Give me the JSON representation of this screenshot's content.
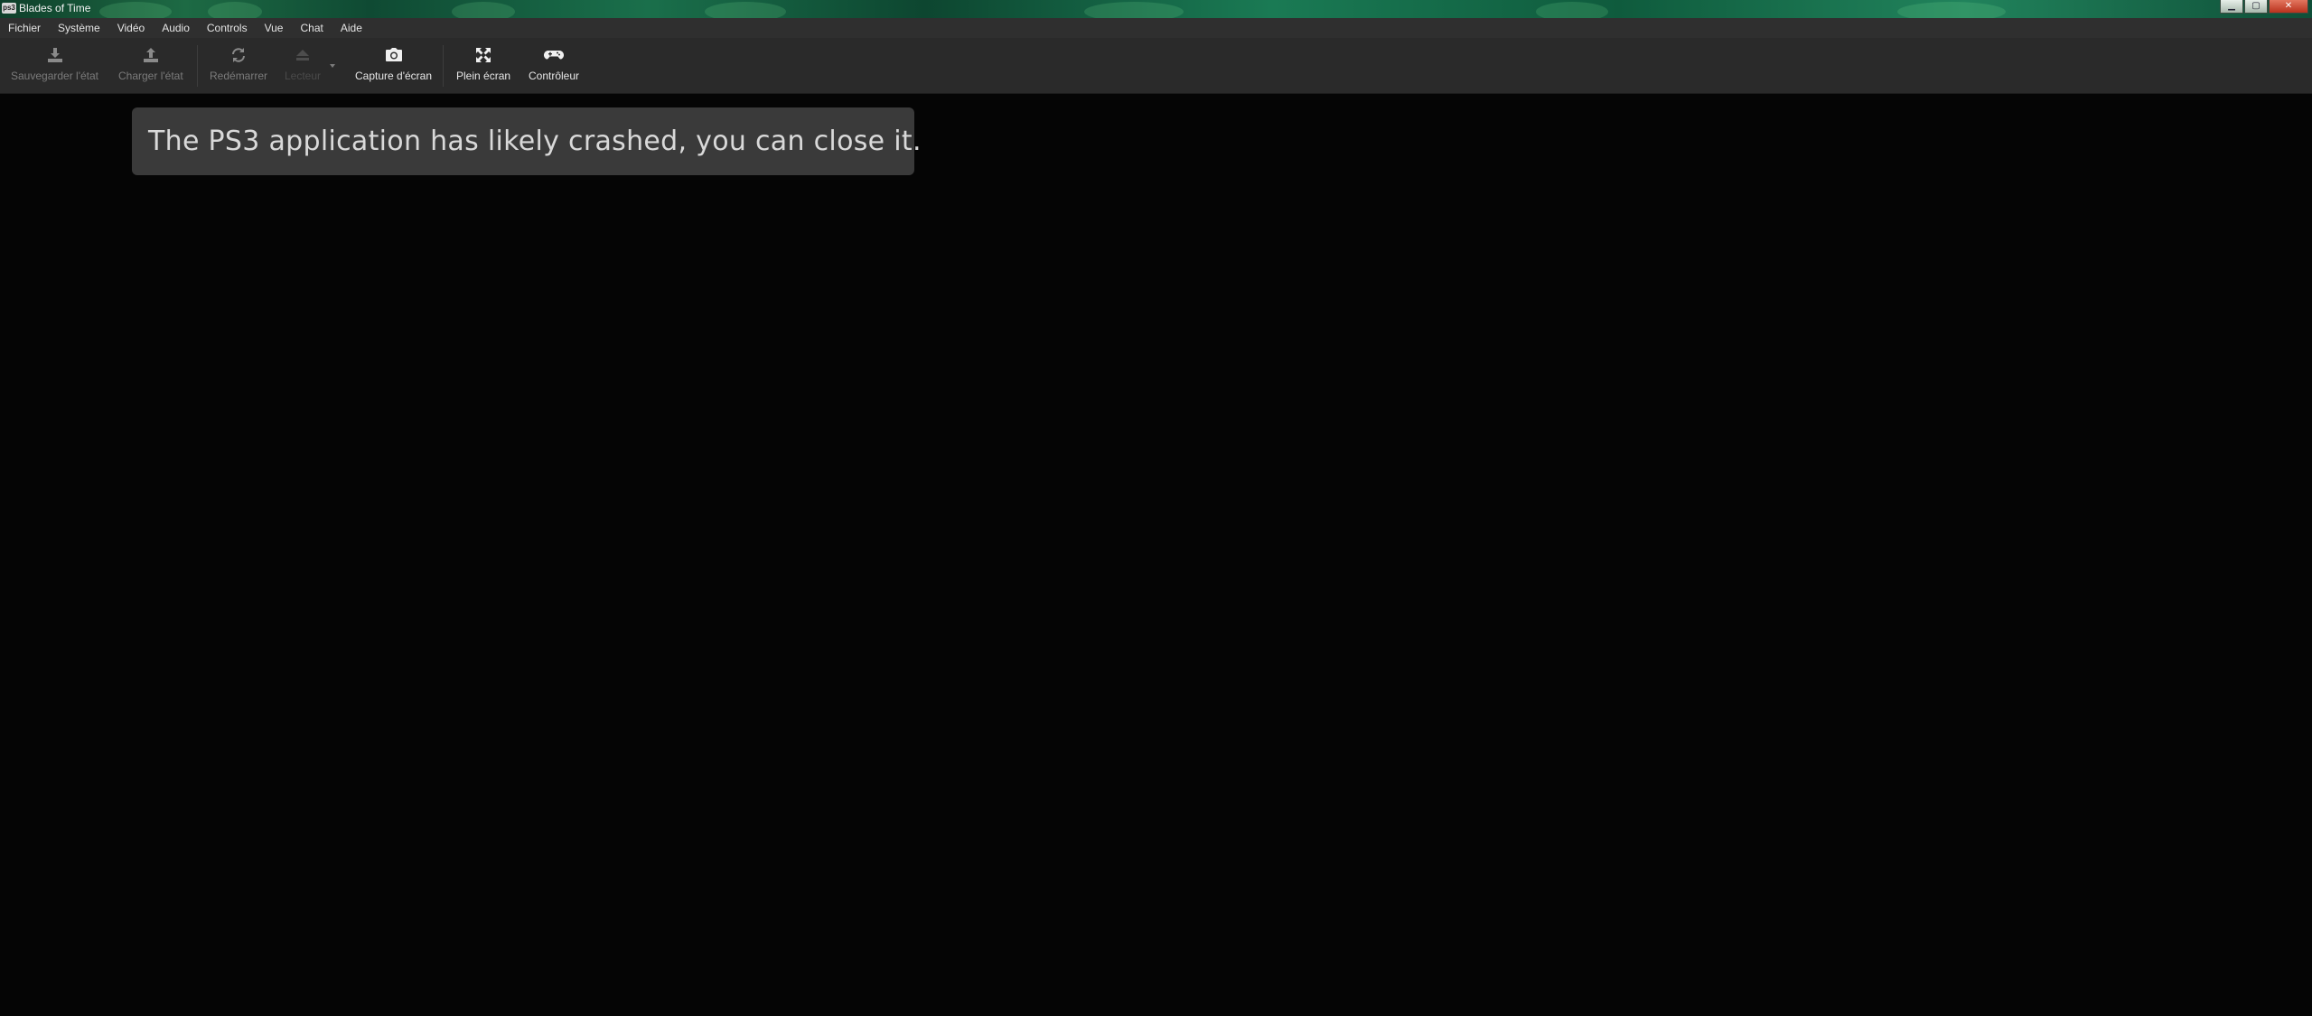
{
  "window": {
    "title": "Blades of Time",
    "icon_name": "rpcs3-icon",
    "icon_text": "ps3",
    "controls": {
      "minimize": "▁",
      "maximize": "▢",
      "close": "✕"
    }
  },
  "menu": {
    "items": [
      "Fichier",
      "Système",
      "Vidéo",
      "Audio",
      "Controls",
      "Vue",
      "Chat",
      "Aide"
    ]
  },
  "toolbar": {
    "save_state": {
      "label": "Sauvegarder l'état",
      "icon": "download-icon",
      "state": "disabled"
    },
    "load_state": {
      "label": "Charger l'état",
      "icon": "upload-icon",
      "state": "disabled"
    },
    "restart": {
      "label": "Redémarrer",
      "icon": "refresh-icon",
      "state": "disabled"
    },
    "launch": {
      "label": "Lecteur",
      "icon": "eject-icon",
      "state": "disabled"
    },
    "screenshot": {
      "label": "Capture d'écran",
      "icon": "camera-icon",
      "state": "enabled"
    },
    "fullscreen": {
      "label": "Plein écran",
      "icon": "fullscreen-icon",
      "state": "enabled"
    },
    "controller": {
      "label": "Contrôleur",
      "icon": "gamepad-icon",
      "state": "enabled"
    }
  },
  "game_area": {
    "message": "The PS3 application has likely crashed, you can close it."
  },
  "colors": {
    "titlebar_green": "#1a6f4b",
    "menubar_bg": "#2f2f2f",
    "toolbar_bg": "#2a2a2a",
    "game_bg": "#050505",
    "toast_bg": "#3a3a3a",
    "close_red": "#c8442a"
  }
}
